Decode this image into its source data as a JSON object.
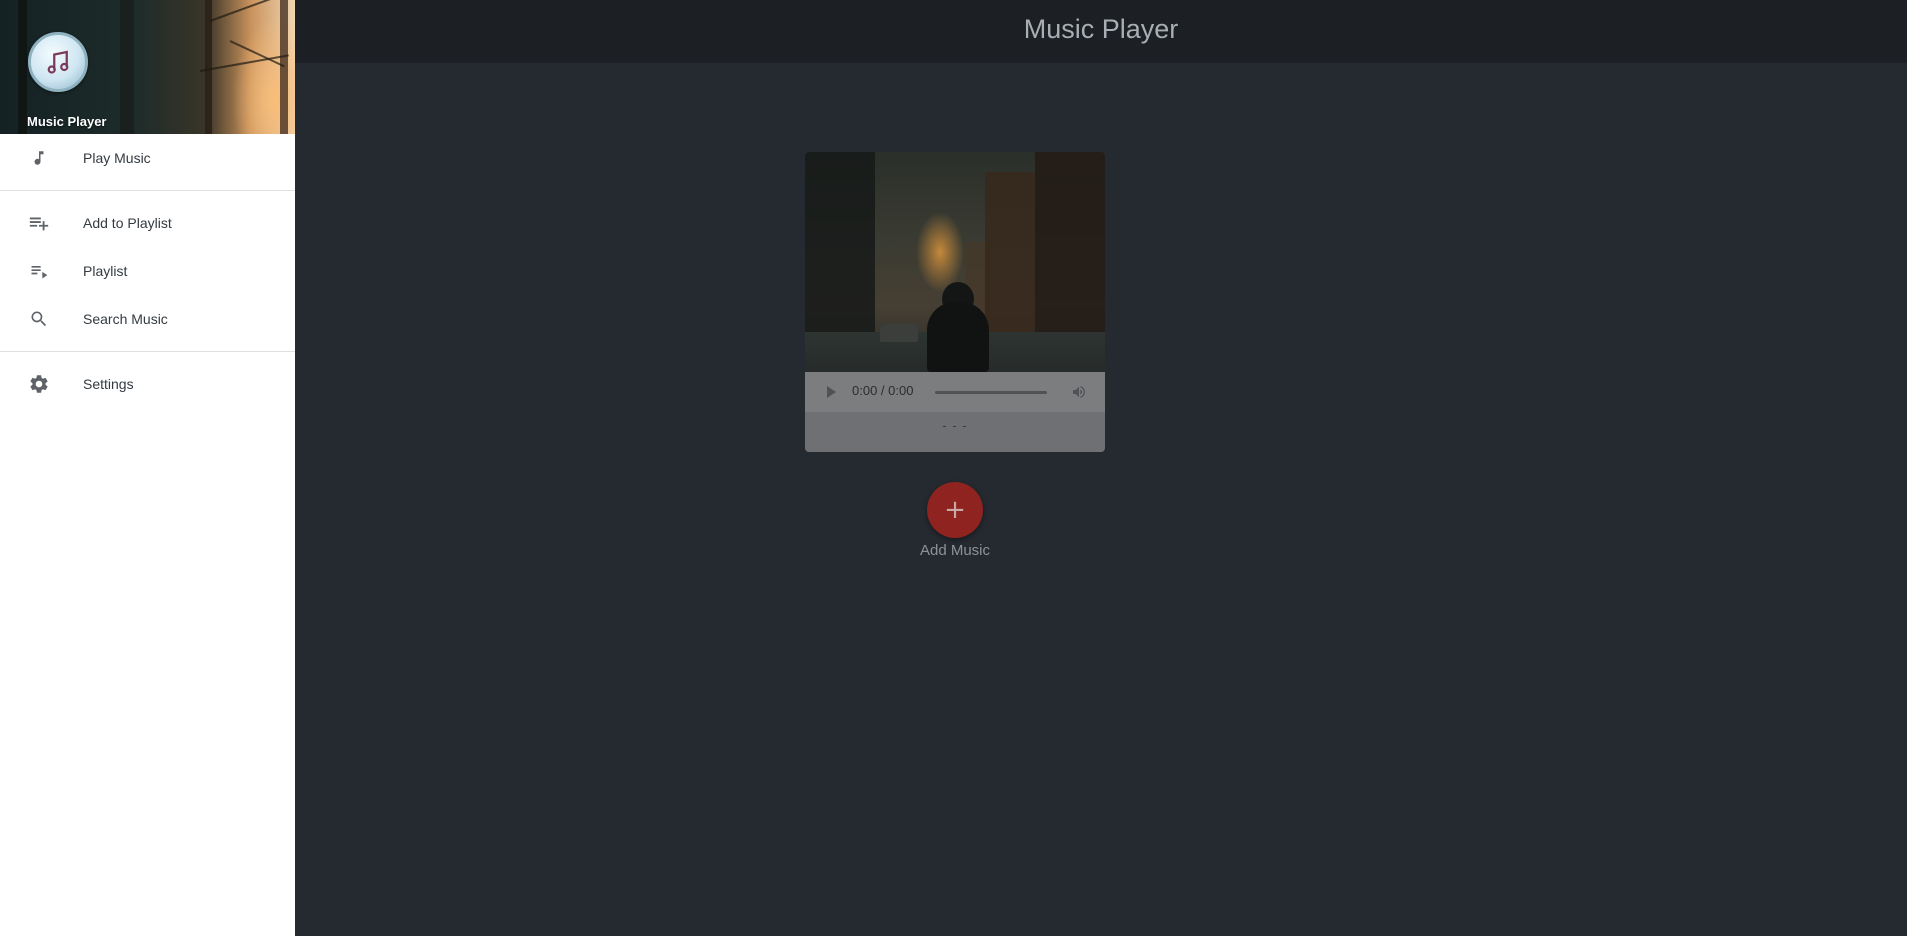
{
  "drawer": {
    "title": "Music Player",
    "logo_icon": "music-note-icon",
    "items": [
      {
        "label": "Play Music",
        "icon": "music-note-icon"
      },
      {
        "label": "Add to Playlist",
        "icon": "playlist-add-icon"
      },
      {
        "label": "Playlist",
        "icon": "playlist-play-icon"
      },
      {
        "label": "Search Music",
        "icon": "search-icon"
      },
      {
        "label": "Settings",
        "icon": "gear-icon"
      }
    ]
  },
  "topbar": {
    "title": "Music Player"
  },
  "player": {
    "time": "0:00 / 0:00",
    "song_title": "- - -",
    "progress": 0
  },
  "fab": {
    "symbol": "+",
    "label": "Add Music",
    "color": "#8e231f"
  },
  "colors": {
    "background": "#252a31",
    "topbar": "#1c2025",
    "drawer": "#ffffff"
  }
}
